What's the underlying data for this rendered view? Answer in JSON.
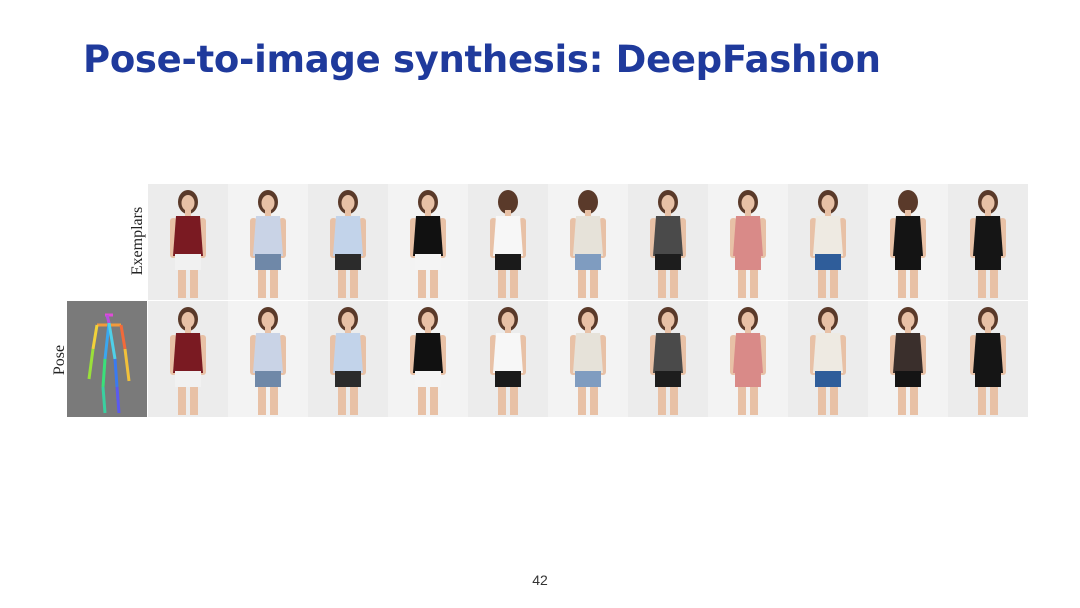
{
  "slide": {
    "title": "Pose-to-image synthesis: DeepFashion",
    "labels": {
      "exemplars": "Exemplars",
      "pose": "Pose"
    },
    "page_number": "42"
  },
  "colors": {
    "title": "#1f3a9c",
    "pose_background": "#7a7a7a",
    "photo_background": "#ececec"
  },
  "figure": {
    "pose_icon": "stick-figure-pose-icon",
    "exemplars": [
      {
        "top": "#7a1a22",
        "bottom": "#f1f1f1",
        "view": "front"
      },
      {
        "top": "#c9d3e6",
        "bottom": "#6f88a8",
        "view": "front"
      },
      {
        "top": "#c2d3ea",
        "bottom": "#2b2b2b",
        "view": "side"
      },
      {
        "top": "#111111",
        "bottom": "#f4f4f4",
        "view": "front"
      },
      {
        "top": "#f7f7f7",
        "bottom": "#1a1a1a",
        "view": "back"
      },
      {
        "top": "#e6e2d9",
        "bottom": "#7f9cc0",
        "view": "back"
      },
      {
        "top": "#4a4a4a",
        "bottom": "#1d1d1d",
        "view": "side"
      },
      {
        "top": "#d98a88",
        "bottom": "#d98a88",
        "view": "walk"
      },
      {
        "top": "#eeeae2",
        "bottom": "#2f5d9a",
        "view": "front"
      },
      {
        "top": "#141414",
        "bottom": "#141414",
        "view": "back"
      },
      {
        "top": "#151515",
        "bottom": "#151515",
        "view": "side"
      }
    ],
    "generated": [
      {
        "top": "#7a1a22",
        "bottom": "#f1f1f1"
      },
      {
        "top": "#c9d3e6",
        "bottom": "#6f88a8"
      },
      {
        "top": "#c2d3ea",
        "bottom": "#2b2b2b"
      },
      {
        "top": "#111111",
        "bottom": "#f4f4f4"
      },
      {
        "top": "#f7f7f7",
        "bottom": "#1a1a1a"
      },
      {
        "top": "#e6e2d9",
        "bottom": "#7f9cc0"
      },
      {
        "top": "#4a4a4a",
        "bottom": "#1d1d1d"
      },
      {
        "top": "#d98a88",
        "bottom": "#d98a88"
      },
      {
        "top": "#eeeae2",
        "bottom": "#2f5d9a"
      },
      {
        "top": "#3a2f2c",
        "bottom": "#141414"
      },
      {
        "top": "#151515",
        "bottom": "#151515"
      }
    ]
  }
}
